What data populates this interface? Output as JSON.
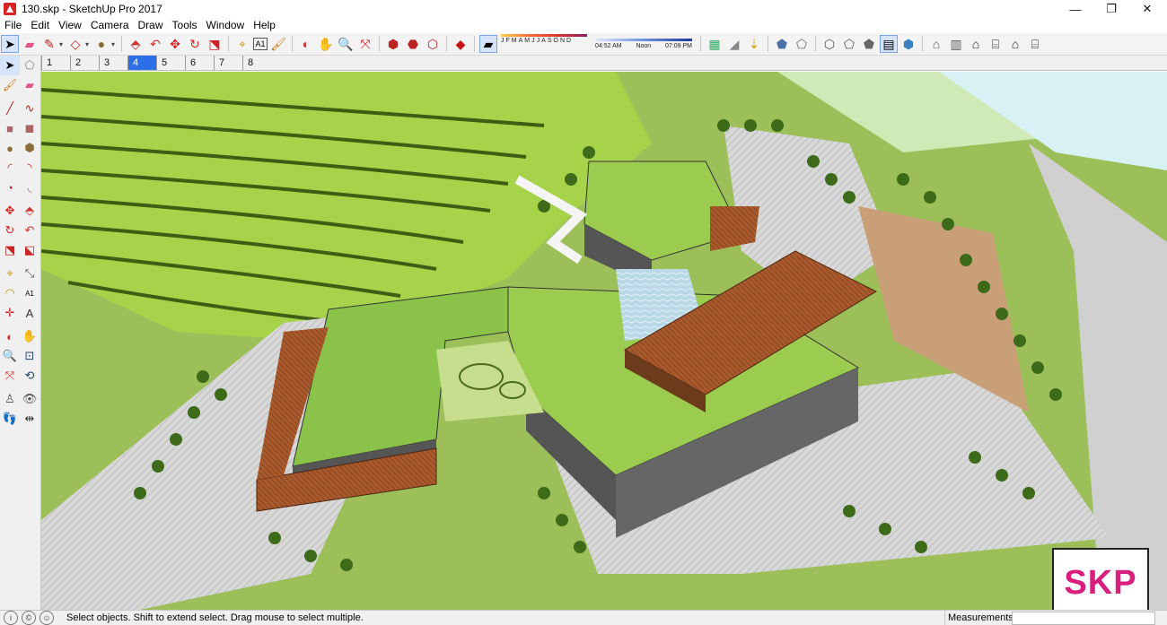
{
  "window": {
    "title": "130.skp - SketchUp Pro 2017",
    "minimize_glyph": "—",
    "maximize_glyph": "❐",
    "close_glyph": "✕"
  },
  "menu": [
    "File",
    "Edit",
    "View",
    "Camera",
    "Draw",
    "Tools",
    "Window",
    "Help"
  ],
  "shadows": {
    "months": [
      "J",
      "F",
      "M",
      "A",
      "M",
      "J",
      "J",
      "A",
      "S",
      "O",
      "N",
      "D"
    ],
    "time_start": "04:52 AM",
    "time_mid": "Noon",
    "time_end": "07:09 PM"
  },
  "scene_tabs": [
    "1",
    "2",
    "3",
    "4",
    "5",
    "6",
    "7",
    "8"
  ],
  "active_scene_tab": "4",
  "status": {
    "message": "Select objects. Shift to extend select. Drag mouse to select multiple.",
    "measurements_label": "Measurements",
    "measurements_value": ""
  },
  "badge": {
    "text": "SKP"
  },
  "colors": {
    "accent": "#2c6fe6",
    "badge_text": "#d91f7d",
    "grass": "#8bc34a",
    "terrace": "#a7d34b",
    "wood": "#a85a2c"
  },
  "toolbar_icons": [
    "select-icon",
    "eraser-icon",
    "pencil-icon",
    "shape-icon",
    "paint-bucket-icon",
    "push-pull-icon",
    "follow-me-icon",
    "move-icon",
    "rotate-icon",
    "scale-icon",
    "tape-measure-icon",
    "text-icon",
    "paint-icon",
    "orbit-icon",
    "pan-icon",
    "zoom-icon",
    "zoom-extents-icon",
    "warehouse-icon",
    "extension-icon",
    "share-icon",
    "ruby-icon",
    "xray-icon",
    "section-icon",
    "fog-icon",
    "sandbox-icon",
    "terrain-icon",
    "iso-view-icon",
    "top-view-icon",
    "front-view-icon",
    "right-view-icon",
    "back-view-icon",
    "left-view-icon"
  ],
  "left_tools": [
    [
      "select-tool-icon",
      "component-tool-icon"
    ],
    [
      "paint-tool-icon",
      "eraser-tool-icon"
    ],
    [
      "line-tool-icon",
      "freehand-tool-icon"
    ],
    [
      "rectangle-tool-icon",
      "rotated-rect-tool-icon"
    ],
    [
      "circle-tool-icon",
      "polygon-tool-icon"
    ],
    [
      "arc-tool-icon",
      "arc3-tool-icon"
    ],
    [
      "pie-tool-icon",
      "arc2-tool-icon"
    ],
    [
      "move-tool-icon",
      "pushpull-tool-icon"
    ],
    [
      "rotate-tool-icon",
      "followme-tool-icon"
    ],
    [
      "scale-tool-icon",
      "offset-tool-icon"
    ],
    [
      "tape-tool-icon",
      "dimension-tool-icon"
    ],
    [
      "protractor-tool-icon",
      "text-tool-icon"
    ],
    [
      "axes-tool-icon",
      "3dtext-tool-icon"
    ],
    [
      "orbit-tool-icon",
      "pan-tool-icon"
    ],
    [
      "zoom-tool-icon",
      "zoom-window-tool-icon"
    ],
    [
      "zoom-extents-tool-icon",
      "previous-tool-icon"
    ],
    [
      "position-camera-tool-icon",
      "look-around-tool-icon"
    ],
    [
      "walk-tool-icon",
      "section-plane-tool-icon"
    ]
  ]
}
